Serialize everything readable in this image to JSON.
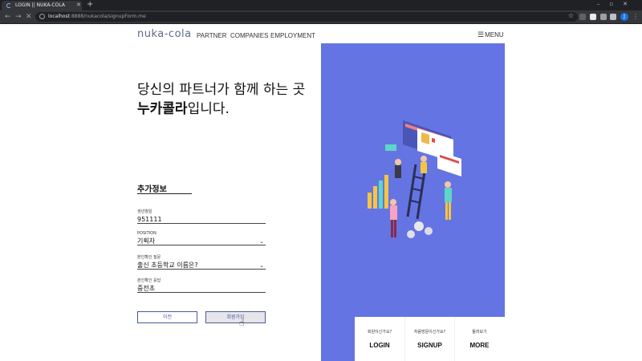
{
  "browser": {
    "tab_title": "LOGIN || NUKA-COLA",
    "url_host": "localhost",
    "url_path": ":8888/nukacola/signupForm.me",
    "profile_initial": "J"
  },
  "header": {
    "logo": "nuka-cola",
    "nav": [
      "PARTNER",
      "COMPANIES",
      "EMPLOYMENT"
    ],
    "menu_label": "MENU"
  },
  "hero": {
    "line1": "당신의 파트너가 함께 하는 곳",
    "line2_strong": "누카콜라",
    "line2_rest": "입니다."
  },
  "form": {
    "section_title": "추가정보",
    "fields": [
      {
        "label": "생년월일",
        "value": "951111"
      },
      {
        "label": "POSITION",
        "value": "기획자"
      },
      {
        "label": "본인확인 질문",
        "value": "출신 초등학교 이름은?"
      },
      {
        "label": "본인확인 응답",
        "value": "중전초"
      }
    ],
    "prev_label": "이전",
    "signup_label": "회원가입"
  },
  "bottom": [
    {
      "sub": "회원이신가요?",
      "main": "LOGIN"
    },
    {
      "sub": "처음방문이신가요?",
      "main": "SIGNUP"
    },
    {
      "sub": "둘러보기",
      "main": "MORE"
    }
  ],
  "colors": {
    "panel": "#6574e3",
    "accent": "#4a5a9a"
  }
}
